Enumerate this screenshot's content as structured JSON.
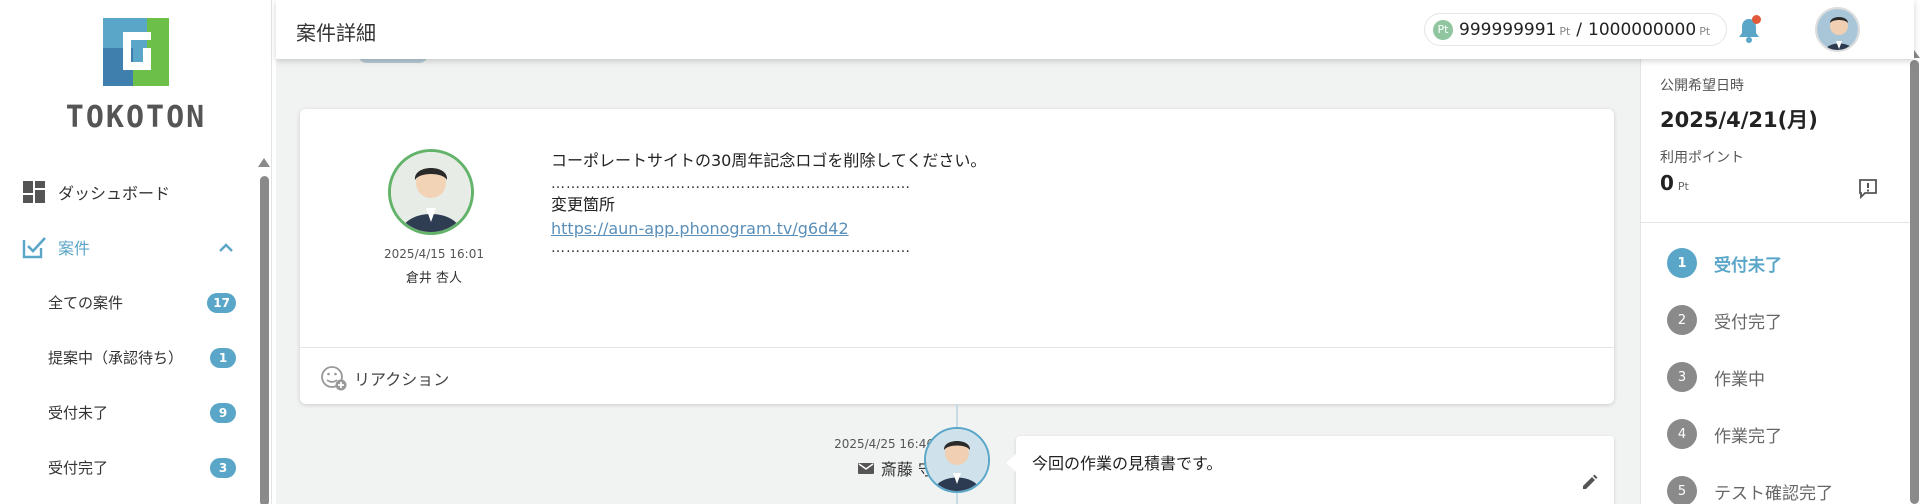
{
  "brand": {
    "logo_text": "TOKOTON"
  },
  "header": {
    "title": "案件詳細",
    "points_current": "999999991",
    "points_unit": "Pt",
    "points_separator": "/",
    "points_total": "1000000000",
    "pt_icon_label": "Pt"
  },
  "sidebar": {
    "dashboard_label": "ダッシュボード",
    "cases_label": "案件",
    "sub_items": [
      {
        "label": "全ての案件",
        "count": "17"
      },
      {
        "label": "提案中（承認待ち）",
        "count": "1"
      },
      {
        "label": "受付未了",
        "count": "9"
      },
      {
        "label": "受付完了",
        "count": "3"
      }
    ]
  },
  "post": {
    "timestamp": "2025/4/15 16:01",
    "author": "倉井 杏人",
    "line1": "コーポレートサイトの30周年記念ロゴを削除してください。",
    "dots": "………………………………………………………………",
    "label_changes": "変更箇所",
    "link": "https://aun-app.phonogram.tv/g6d42",
    "dots2": "………………………………………………………………",
    "reaction_label": "リアクション"
  },
  "message": {
    "timestamp": "2025/4/25 16:46",
    "author": "斎藤 守",
    "text": "今回の作業の見積書です。"
  },
  "panel": {
    "publish_label": "公開希望日時",
    "publish_date": "2025/4/21(月)",
    "points_label": "利用ポイント",
    "points_value": "0",
    "points_unit": "Pt",
    "steps": [
      {
        "num": "1",
        "label": "受付未了"
      },
      {
        "num": "2",
        "label": "受付完了"
      },
      {
        "num": "3",
        "label": "作業中"
      },
      {
        "num": "4",
        "label": "作業完了"
      },
      {
        "num": "5",
        "label": "テスト確認完了"
      }
    ]
  },
  "colors": {
    "accent": "#5aa6c8",
    "badge_bg": "#5aa6c8",
    "notification_dot": "#e05a3a",
    "avatar_ring_green": "#63b36a"
  }
}
